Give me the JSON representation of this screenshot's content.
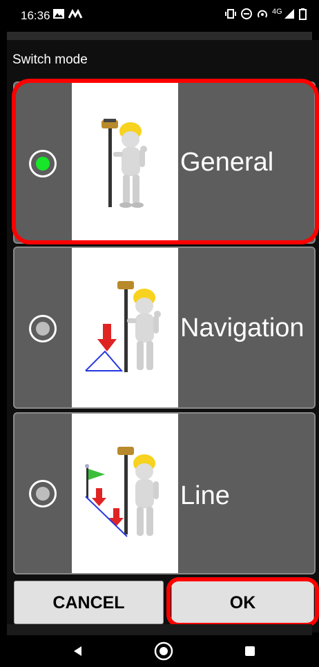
{
  "status_bar": {
    "time": "16:36",
    "network": "4G",
    "icons": [
      "image-icon",
      "m-logo-icon",
      "vibrate-icon",
      "do-not-disturb-icon",
      "hotspot-icon",
      "signal-icon",
      "battery-icon"
    ]
  },
  "dialog": {
    "title": "Switch mode",
    "options": [
      {
        "label": "General",
        "selected": true,
        "icon": "surveyor-general-icon"
      },
      {
        "label": "Navigation",
        "selected": false,
        "icon": "surveyor-navigation-icon"
      },
      {
        "label": "Line",
        "selected": false,
        "icon": "surveyor-line-icon"
      }
    ],
    "cancel_label": "CANCEL",
    "ok_label": "OK"
  },
  "colors": {
    "highlight": "#ff0000",
    "radio_selected": "#17e629",
    "option_bg": "#5d5d5d"
  },
  "nav_bar": {
    "icons": [
      "back-icon",
      "home-icon",
      "recents-icon"
    ]
  }
}
